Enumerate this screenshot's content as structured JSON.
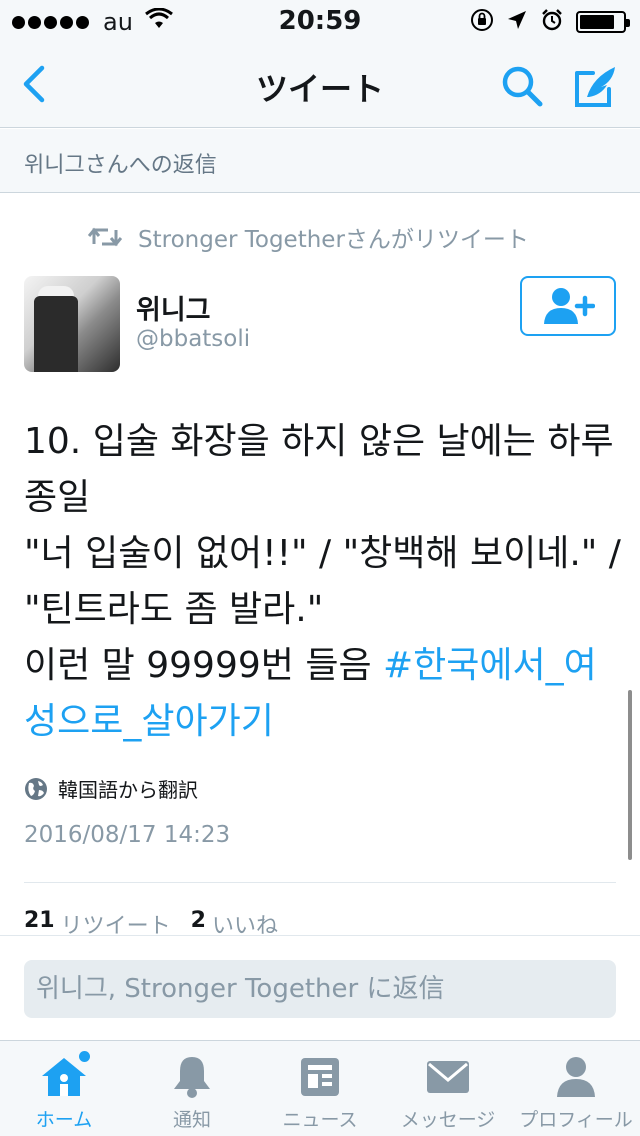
{
  "status_bar": {
    "carrier": "au",
    "time": "20:59",
    "battery_level": 0.82
  },
  "nav": {
    "title": "ツイート"
  },
  "reply_banner": {
    "text": "위니그さんへの返信"
  },
  "retweet_line": {
    "text": "Stronger Togetherさんがリツイート"
  },
  "user": {
    "name": "위니그",
    "handle": "@bbatsoli"
  },
  "tweet": {
    "text": "10. 입술 화장을 하지 않은 날에는 하루종일\n\"너 입술이 없어!!\" / \"창백해 보이네.\" / \"틴트라도 좀 발라.\"\n이런 말 99999번 들음 ",
    "hashtag": "#한국에서_여성으로_살아가기",
    "translated_label": "韓国語から翻訳",
    "timestamp": "2016/08/17 14:23"
  },
  "stats": {
    "retweet_count": "21",
    "retweet_label": "リツイート",
    "like_count": "2",
    "like_label": "いいね"
  },
  "reply_input": {
    "placeholder": "위니그, Stronger Together に返信"
  },
  "tabs": [
    {
      "label": "ホーム",
      "icon": "home-icon",
      "active": true
    },
    {
      "label": "通知",
      "icon": "bell-icon",
      "active": false
    },
    {
      "label": "ニュース",
      "icon": "news-icon",
      "active": false
    },
    {
      "label": "メッセージ",
      "icon": "envelope-icon",
      "active": false
    },
    {
      "label": "プロフィール",
      "icon": "profile-icon",
      "active": false
    }
  ],
  "colors": {
    "accent": "#1da1f2",
    "muted": "#8899a6",
    "text": "#14171a",
    "bar_background": "#f5f8fa"
  }
}
